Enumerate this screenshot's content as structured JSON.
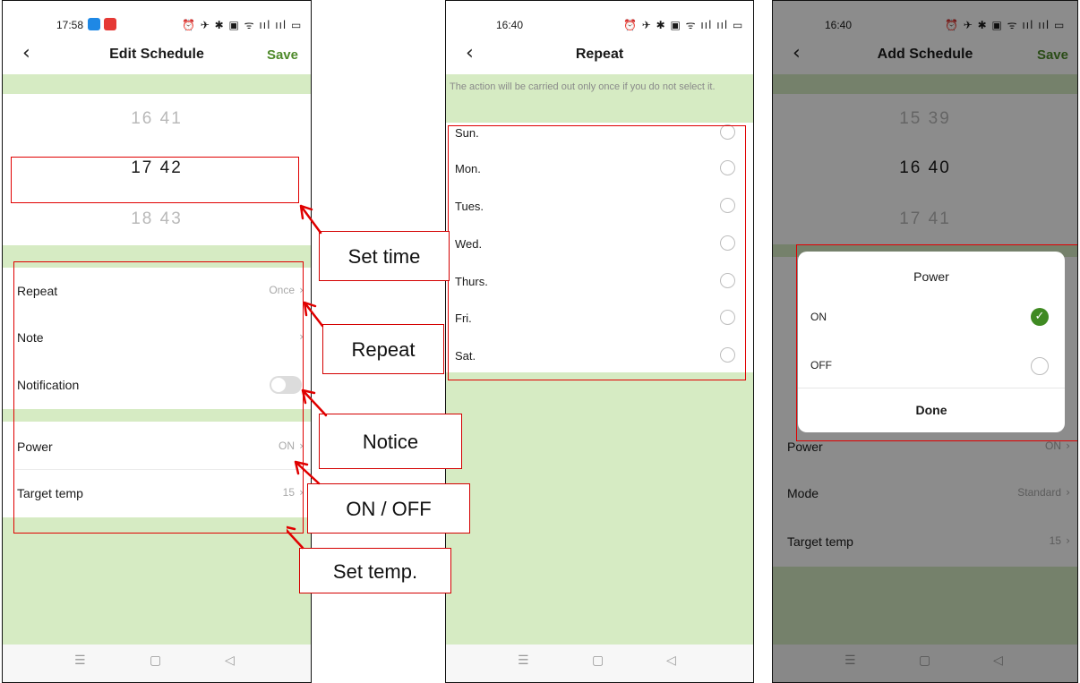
{
  "left_screen": {
    "status_time": "17:58",
    "status_icons": "⏰ ✈ ✱ ▣ ᯤ ııl ııl ▭",
    "back_glyph": "‹",
    "title": "Edit Schedule",
    "save_label": "Save",
    "picker": {
      "prev": "16  41",
      "current": "17  42",
      "next": "18  43"
    },
    "rows": [
      {
        "label": "Repeat",
        "value": "Once"
      },
      {
        "label": "Note",
        "value": ""
      },
      {
        "label": "Notification",
        "value": ""
      },
      {
        "label": "Power",
        "value": "ON"
      },
      {
        "label": "Target temp",
        "value": "15"
      }
    ],
    "notification_on": false
  },
  "middle_screen": {
    "status_time": "16:40",
    "status_icons": "⏰ ✈ ✱ ▣ ᯤ ııl ııl ▭",
    "back_glyph": "‹",
    "title": "Repeat",
    "hint": "The action will be carried out only once if you do not select it.",
    "days": [
      "Sun.",
      "Mon.",
      "Tues.",
      "Wed.",
      "Thurs.",
      "Fri.",
      "Sat."
    ]
  },
  "right_screen": {
    "status_time": "16:40",
    "status_icons": "⏰ ✈ ✱ ▣ ᯤ ııl ııl ▭",
    "back_glyph": "‹",
    "title": "Add Schedule",
    "save_label": "Save",
    "picker": {
      "prev": "15  39",
      "current": "16  40",
      "next": "17  41"
    },
    "rows": [
      {
        "label": "Power",
        "value": "ON"
      },
      {
        "label": "Mode",
        "value": "Standard"
      },
      {
        "label": "Target temp",
        "value": "15"
      }
    ],
    "dialog": {
      "title": "Power",
      "options": [
        {
          "label": "ON",
          "selected": true
        },
        {
          "label": "OFF",
          "selected": false
        }
      ],
      "done_label": "Done"
    }
  },
  "nav_glyphs": {
    "menu": "☰",
    "home": "▢",
    "back": "◁"
  },
  "callouts": {
    "set_time": "Set time",
    "repeat": "Repeat",
    "notice": "Notice",
    "on_off": "ON / OFF",
    "set_temp": "Set temp."
  },
  "colors": {
    "accent_green": "#4e8a2a",
    "band_green": "#d6ebc3",
    "annotation_red": "#e00000"
  }
}
